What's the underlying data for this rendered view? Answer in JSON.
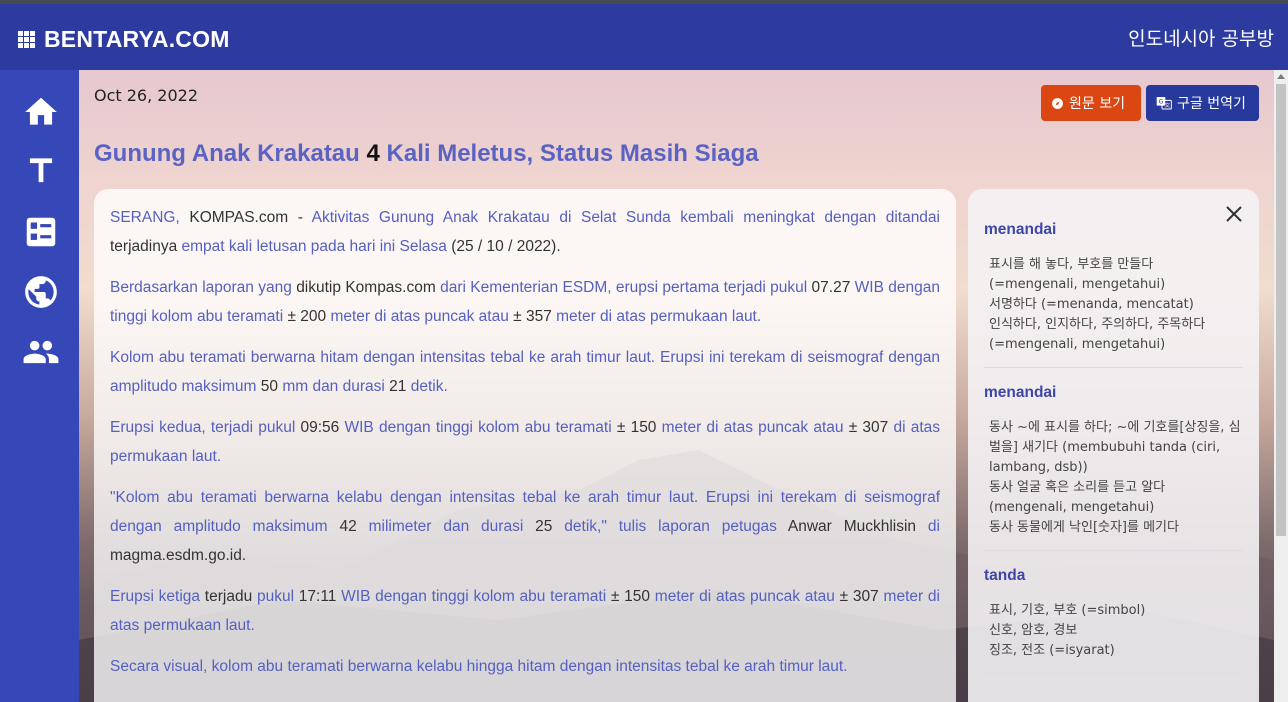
{
  "header": {
    "brand": "BENTARYA.COM",
    "subtitle": "인도네시아 공부방"
  },
  "sidebar": {
    "items": [
      {
        "icon": "home-icon"
      },
      {
        "icon": "text-icon"
      },
      {
        "icon": "list-icon"
      },
      {
        "icon": "globe-icon"
      },
      {
        "icon": "people-icon"
      }
    ]
  },
  "page": {
    "date": "Oct 26, 2022",
    "btn_original": "원문 보기",
    "btn_translate": "구글 번역기",
    "title_a": "Gunung Anak Krakatau ",
    "title_num": "4",
    "title_b": " Kali Meletus, Status Masih Siaga"
  },
  "article": {
    "p1": [
      {
        "t": "SERANG, ",
        "h": true
      },
      {
        "t": "KOMPAS.com - ",
        "h": false
      },
      {
        "t": "Aktivitas Gunung Anak Krakatau di Selat Sunda kembali meningkat dengan ditandai ",
        "h": true
      },
      {
        "t": "terjadinya ",
        "h": false
      },
      {
        "t": "empat kali letusan pada hari ini Selasa ",
        "h": true
      },
      {
        "t": "(25 / 10 / 2022).",
        "h": false
      }
    ],
    "p2": [
      {
        "t": "Berdasarkan laporan yang ",
        "h": true
      },
      {
        "t": "dikutip Kompas.com ",
        "h": false
      },
      {
        "t": "dari Kementerian ESDM, erupsi pertama terjadi pukul ",
        "h": true
      },
      {
        "t": "07.27 ",
        "h": false
      },
      {
        "t": "WIB dengan tinggi kolom abu teramati ",
        "h": true
      },
      {
        "t": "± 200 ",
        "h": false
      },
      {
        "t": "meter di atas puncak atau ",
        "h": true
      },
      {
        "t": "± 357 ",
        "h": false
      },
      {
        "t": "meter di atas permukaan laut.",
        "h": true
      }
    ],
    "p3": [
      {
        "t": "Kolom abu teramati berwarna hitam dengan intensitas tebal ke arah timur laut. Erupsi ini terekam di seismograf dengan amplitudo maksimum ",
        "h": true
      },
      {
        "t": "50 ",
        "h": false
      },
      {
        "t": "mm dan durasi ",
        "h": true
      },
      {
        "t": "21 ",
        "h": false
      },
      {
        "t": "detik.",
        "h": true
      }
    ],
    "p4": [
      {
        "t": "Erupsi kedua, terjadi pukul ",
        "h": true
      },
      {
        "t": "09:56 ",
        "h": false
      },
      {
        "t": "WIB dengan tinggi kolom abu teramati ",
        "h": true
      },
      {
        "t": "± 150 ",
        "h": false
      },
      {
        "t": "meter di atas puncak atau ",
        "h": true
      },
      {
        "t": "± 307  ",
        "h": false
      },
      {
        "t": "di atas permukaan laut.",
        "h": true
      }
    ],
    "p5": [
      {
        "t": "\"Kolom abu teramati berwarna kelabu dengan intensitas tebal ke arah timur laut. Erupsi ini terekam di seismograf dengan amplitudo maksimum ",
        "h": true
      },
      {
        "t": "42 ",
        "h": false
      },
      {
        "t": "milimeter dan durasi ",
        "h": true
      },
      {
        "t": "25 ",
        "h": false
      },
      {
        "t": "detik,\" tulis laporan petugas ",
        "h": true
      },
      {
        "t": "Anwar Muckhlisin ",
        "h": false
      },
      {
        "t": "di ",
        "h": true
      },
      {
        "t": "magma.esdm.go.id.",
        "h": false
      }
    ],
    "p6": [
      {
        "t": "Erupsi ketiga ",
        "h": true
      },
      {
        "t": "terjadu ",
        "h": false
      },
      {
        "t": "pukul ",
        "h": true
      },
      {
        "t": "17:11 ",
        "h": false
      },
      {
        "t": "WIB dengan tinggi kolom abu teramati ",
        "h": true
      },
      {
        "t": "± 150 ",
        "h": false
      },
      {
        "t": "meter di atas puncak atau ",
        "h": true
      },
      {
        "t": "± 307 ",
        "h": false
      },
      {
        "t": "meter di atas permukaan laut.",
        "h": true
      }
    ],
    "p7": [
      {
        "t": "Secara visual, kolom abu teramati berwarna kelabu hingga hitam dengan intensitas tebal ke arah timur laut.",
        "h": true
      }
    ]
  },
  "dictionary": {
    "entries": [
      {
        "word": "menandai",
        "lines": [
          "표시를 해 놓다, 부호를 만들다 (=mengenali, mengetahui)",
          "서명하다 (=menanda, mencatat)",
          "인식하다, 인지하다, 주의하다, 주목하다 (=mengenali, mengetahui)"
        ]
      },
      {
        "word": "menandai",
        "lines": [
          "동사 ~에 표시를 하다; ~에 기호를[상징을, 심벌을] 새기다 (membubuhi tanda (ciri, lambang, dsb))",
          "동사 얼굴 혹은 소리를 듣고 알다 (mengenali, mengetahui)",
          "동사 동물에게 낙인[숫자]를 메기다"
        ]
      },
      {
        "word": "tanda",
        "lines": [
          "표시, 기호, 부호 (=simbol)",
          "신호, 암호, 경보",
          "징조, 전조 (=isyarat)"
        ]
      }
    ]
  }
}
